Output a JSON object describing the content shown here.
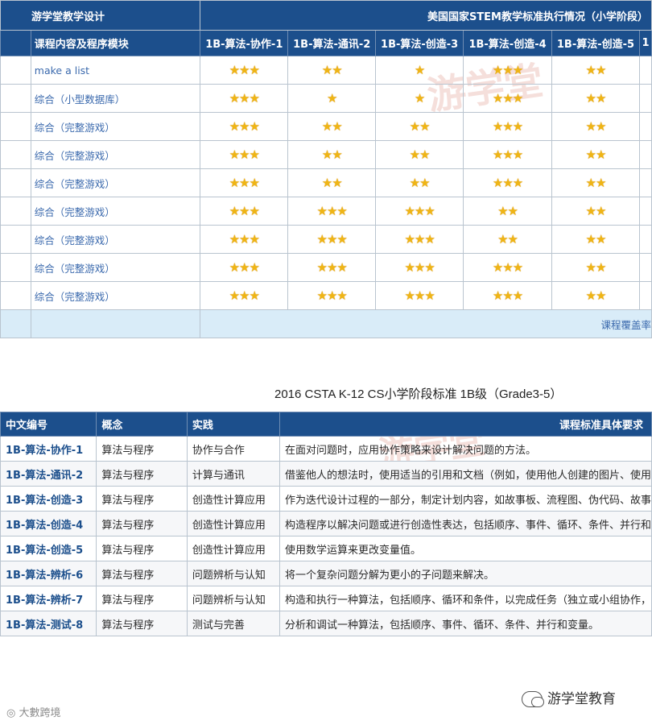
{
  "table1": {
    "header_left": "游学堂教学设计",
    "header_right": "美国国家STEM教学标准执行情况（小学阶段）",
    "col_course": "课程内容及程序模块",
    "columns": [
      "1B-算法-协作-1",
      "1B-算法-通讯-2",
      "1B-算法-创造-3",
      "1B-算法-创造-4",
      "1B-算法-创造-5",
      "1"
    ],
    "rows": [
      {
        "name": "make a list",
        "stars": [
          "★★★",
          "★★",
          "★",
          "★★★",
          "★★"
        ]
      },
      {
        "name": "综合（小型数据库）",
        "stars": [
          "★★★",
          "★",
          "★",
          "★★★",
          "★★"
        ]
      },
      {
        "name": "综合（完整游戏）",
        "stars": [
          "★★★",
          "★★",
          "★★",
          "★★★",
          "★★"
        ]
      },
      {
        "name": "综合（完整游戏）",
        "stars": [
          "★★★",
          "★★",
          "★★",
          "★★★",
          "★★"
        ]
      },
      {
        "name": "综合（完整游戏）",
        "stars": [
          "★★★",
          "★★",
          "★★",
          "★★★",
          "★★"
        ]
      },
      {
        "name": "综合（完整游戏）",
        "stars": [
          "★★★",
          "★★★",
          "★★★",
          "★★",
          "★★"
        ]
      },
      {
        "name": "综合（完整游戏）",
        "stars": [
          "★★★",
          "★★★",
          "★★★",
          "★★",
          "★★"
        ]
      },
      {
        "name": "综合（完整游戏）",
        "stars": [
          "★★★",
          "★★★",
          "★★★",
          "★★★",
          "★★"
        ]
      },
      {
        "name": "综合（完整游戏）",
        "stars": [
          "★★★",
          "★★★",
          "★★★",
          "★★★",
          "★★"
        ]
      }
    ],
    "footer": "课程覆盖率"
  },
  "table2": {
    "title": "2016 CSTA K-12 CS小学阶段标准 1B级（Grade3-5）",
    "headers": {
      "code": "中文编号",
      "concept": "概念",
      "practice": "实践",
      "req": "课程标准具体要求"
    },
    "rows": [
      {
        "code": "1B-算法-协作-1",
        "concept": "算法与程序",
        "practice": "协作与合作",
        "req": "在面对问题时，应用协作策略来设计解决问题的方法。"
      },
      {
        "code": "1B-算法-通讯-2",
        "concept": "算法与程序",
        "practice": "计算与通讯",
        "req": "借鉴他人的想法时，使用适当的引用和文档（例如，使用他人创建的图片、使用"
      },
      {
        "code": "1B-算法-创造-3",
        "concept": "算法与程序",
        "practice": "创造性计算应用",
        "req": "作为迭代设计过程的一部分，制定计划内容，如故事板、流程图、伪代码、故事"
      },
      {
        "code": "1B-算法-创造-4",
        "concept": "算法与程序",
        "practice": "创造性计算应用",
        "req": "构造程序以解决问题或进行创造性表达，包括顺序、事件、循环、条件、并行和"
      },
      {
        "code": "1B-算法-创造-5",
        "concept": "算法与程序",
        "practice": "创造性计算应用",
        "req": "使用数学运算来更改变量值。"
      },
      {
        "code": "1B-算法-辨析-6",
        "concept": "算法与程序",
        "practice": "问题辨析与认知",
        "req": "将一个复杂问题分解为更小的子问题来解决。"
      },
      {
        "code": "1B-算法-辨析-7",
        "concept": "算法与程序",
        "practice": "问题辨析与认知",
        "req": "构造和执行一种算法，包括顺序、循环和条件，以完成任务（独立或小组协作，"
      },
      {
        "code": "1B-算法-测试-8",
        "concept": "算法与程序",
        "practice": "测试与完善",
        "req": "分析和调试一种算法，包括顺序、事件、循环、条件、并行和变量。"
      }
    ]
  },
  "watermark": "游学堂",
  "footer_left": "大數跨境",
  "footer_right": "游学堂教育"
}
